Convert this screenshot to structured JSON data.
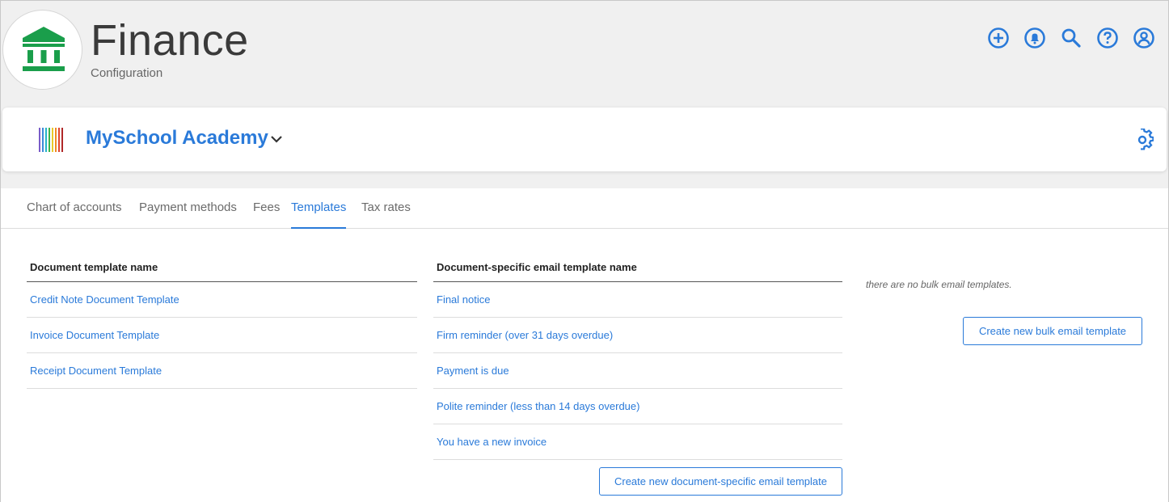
{
  "header": {
    "title": "Finance",
    "subtitle": "Configuration",
    "icons": [
      "add-circle-icon",
      "bell-icon",
      "search-icon",
      "help-icon",
      "account-icon"
    ]
  },
  "school": {
    "name": "MySchool Academy"
  },
  "tabs": [
    {
      "label": "Chart of accounts"
    },
    {
      "label": "Payment methods"
    },
    {
      "label": "Fees"
    },
    {
      "label": "Templates",
      "active": true
    },
    {
      "label": "Tax rates"
    }
  ],
  "document_templates": {
    "header": "Document template name",
    "items": [
      "Credit Note Document Template",
      "Invoice Document Template",
      "Receipt Document Template"
    ]
  },
  "email_templates": {
    "header": "Document-specific email template name",
    "items": [
      "Final notice",
      "Firm reminder (over 31 days overdue)",
      "Payment is due",
      "Polite reminder (less than 14 days overdue)",
      "You have a new invoice"
    ],
    "create_button": "Create new document-specific email template"
  },
  "bulk_email": {
    "empty_text": "there are no bulk email templates.",
    "create_button": "Create new bulk email template"
  },
  "colors": {
    "accent": "#2a7ad9",
    "logo_green": "#1a9e4b"
  }
}
